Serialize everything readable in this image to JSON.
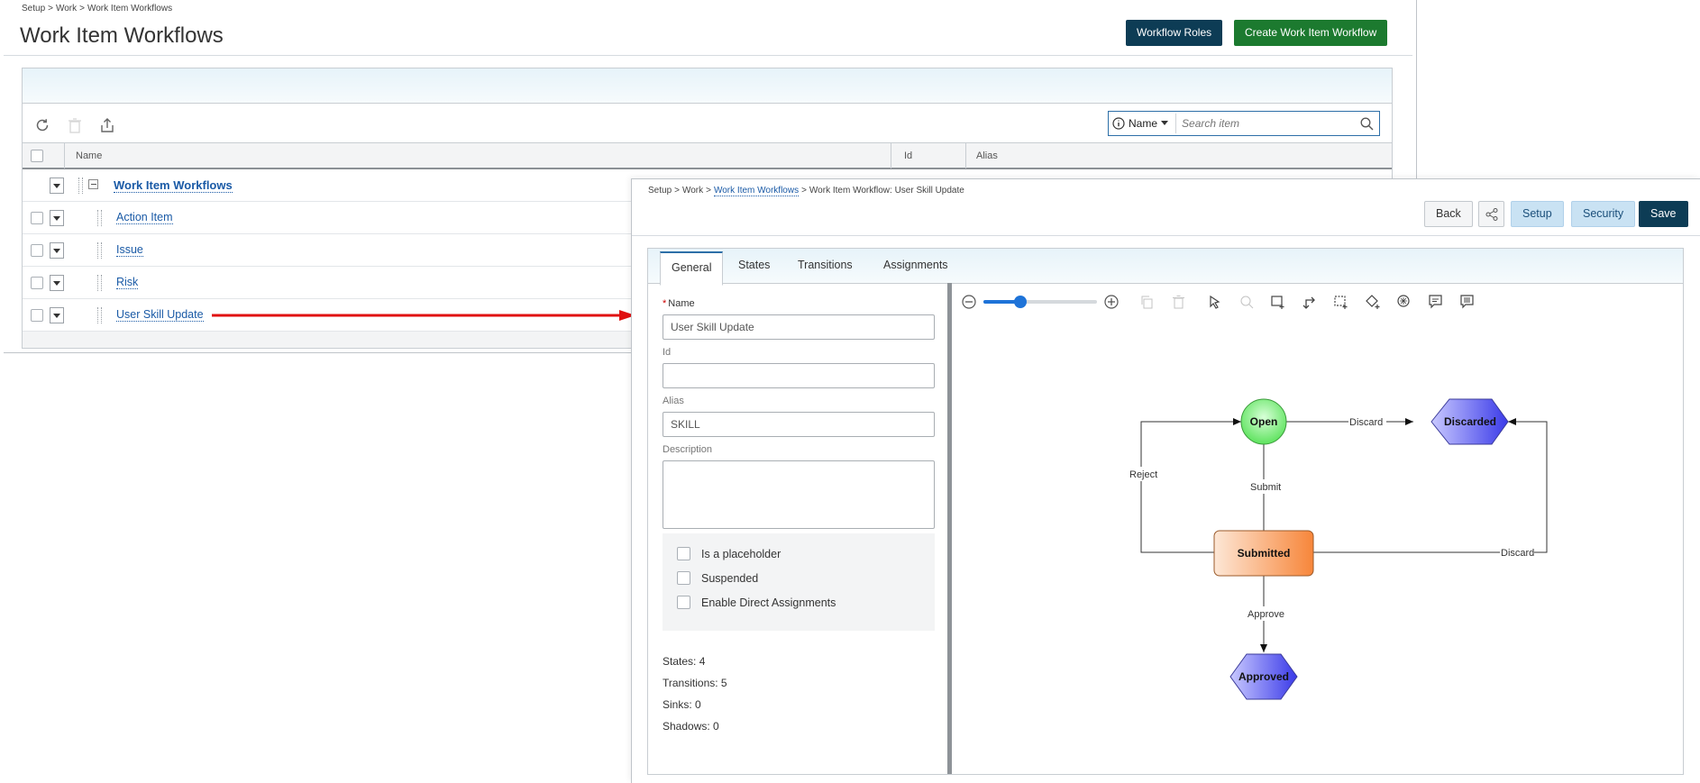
{
  "list_window": {
    "breadcrumb": [
      "Setup",
      "Work",
      "Work Item Workflows"
    ],
    "title": "Work Item Workflows",
    "buttons": {
      "roles": "Workflow Roles",
      "create": "Create Work Item Workflow"
    },
    "search": {
      "field_label": "Name",
      "placeholder": "Search item"
    },
    "columns": {
      "name": "Name",
      "id": "Id",
      "alias": "Alias"
    },
    "group_label": "Work Item Workflows",
    "rows": [
      "Action Item",
      "Issue",
      "Risk",
      "User Skill Update"
    ]
  },
  "detail_window": {
    "breadcrumb": {
      "root": "Setup",
      "mid": "Work",
      "link": "Work Item Workflows",
      "current": "Work Item Workflow: User Skill Update"
    },
    "buttons": {
      "back": "Back",
      "setup": "Setup",
      "security": "Security",
      "save": "Save"
    },
    "tabs": [
      "General",
      "States",
      "Transitions",
      "Assignments"
    ],
    "form": {
      "name_label": "Name",
      "name_value": "User Skill Update",
      "id_label": "Id",
      "id_value": "",
      "alias_label": "Alias",
      "alias_value": "SKILL",
      "description_label": "Description",
      "description_value": ""
    },
    "checkboxes": [
      "Is a placeholder",
      "Suspended",
      "Enable Direct Assignments"
    ],
    "stats": [
      "States: 4",
      "Transitions: 5",
      "Sinks: 0",
      "Shadows: 0"
    ],
    "zoom_percent": 30,
    "diagram": {
      "nodes": {
        "open": "Open",
        "discarded": "Discarded",
        "submitted": "Submitted",
        "approved": "Approved"
      },
      "edges": {
        "discard1": "Discard",
        "submit": "Submit",
        "reject": "Reject",
        "discard2": "Discard",
        "approve": "Approve"
      },
      "colors": {
        "open": "#5ee35e",
        "submitted": "#f7a062",
        "hex": "#5e5ef0"
      }
    }
  }
}
